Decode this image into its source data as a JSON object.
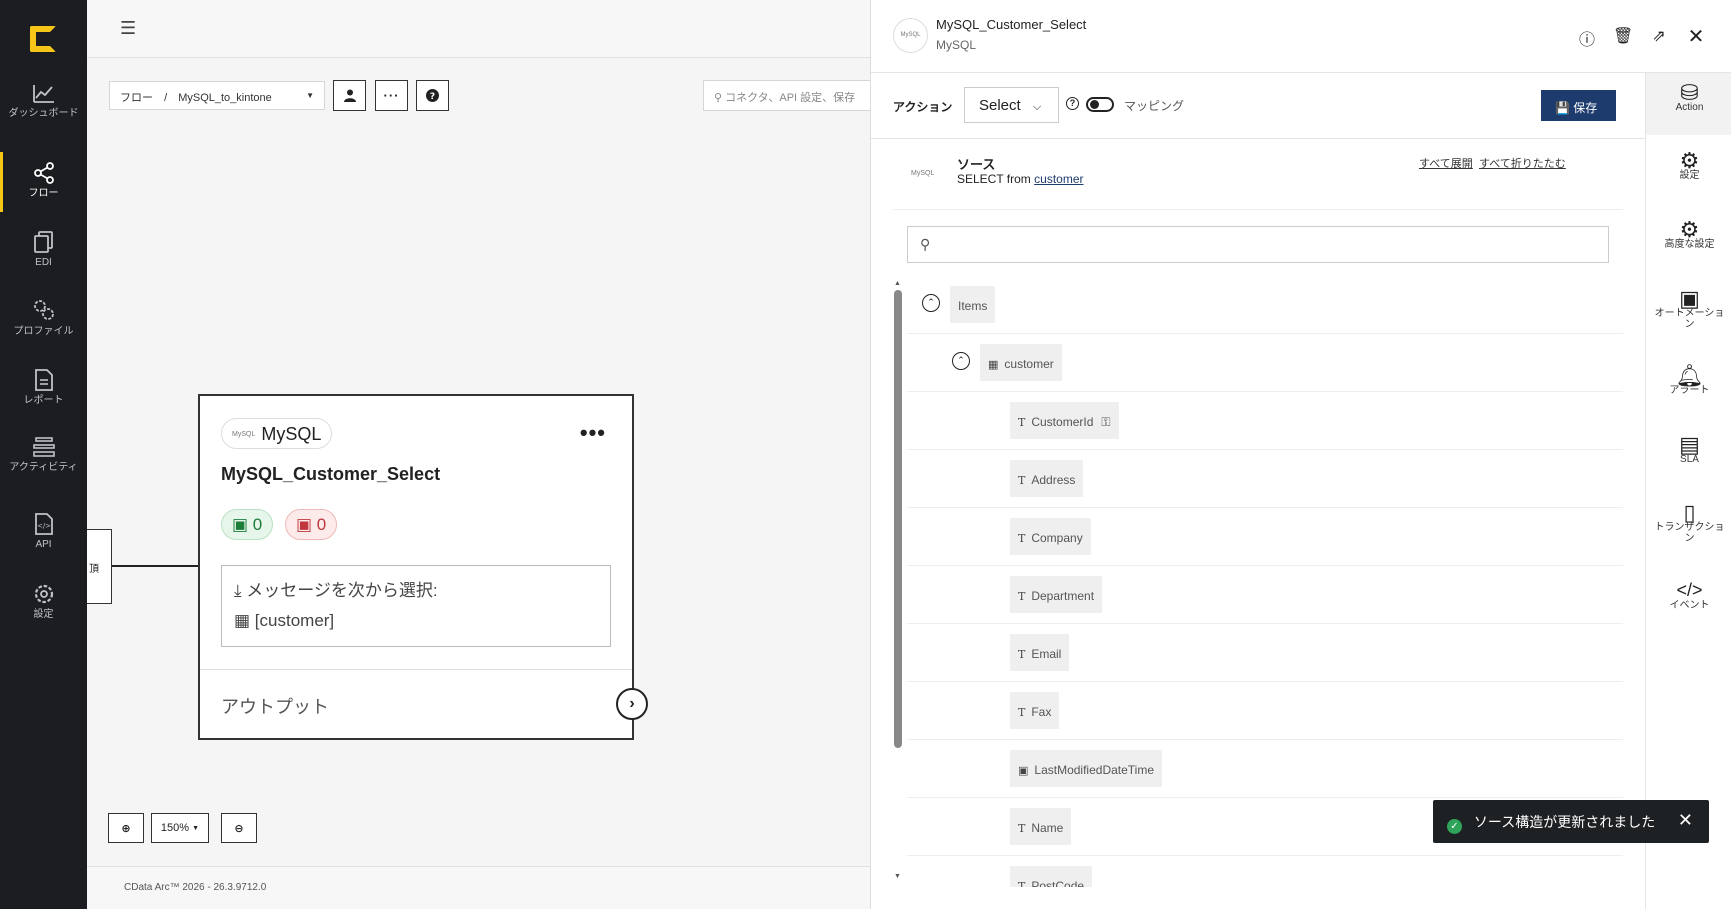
{
  "nav": {
    "items": [
      {
        "label": "ダッシュボード",
        "icon": "chart-line-icon"
      },
      {
        "label": "フロー",
        "icon": "share-nodes-icon"
      },
      {
        "label": "EDI",
        "icon": "documents-icon"
      },
      {
        "label": "プロファイル",
        "icon": "gears-icon"
      },
      {
        "label": "レポート",
        "icon": "report-icon"
      },
      {
        "label": "アクティビティ",
        "icon": "layers-icon"
      },
      {
        "label": "API",
        "icon": "api-file-icon"
      },
      {
        "label": "設定",
        "icon": "gear-icon"
      }
    ]
  },
  "canvas": {
    "breadcrumb_root": "フロー",
    "breadcrumb_sep": "/",
    "breadcrumb_current": "MySQL_to_kintone",
    "search_placeholder": "コネクタ、API 設定、保存",
    "stub_label": "頂",
    "zoom": "150%",
    "footer": "CData Arc™ 2026 - 26.3.9712.0"
  },
  "node": {
    "type": "MySQL",
    "type_mini": "MySQL",
    "title": "MySQL_Customer_Select",
    "ok_count": "0",
    "err_count": "0",
    "msg_label": "メッセージを次から選択:",
    "msg_table": "[customer]",
    "output": "アウトプット"
  },
  "panel": {
    "name": "MySQL_Customer_Select",
    "sub": "MySQL",
    "logo_text": "MySQL",
    "action_label": "アクション",
    "action_value": "Select",
    "mapping_label": "マッピング",
    "save_label": "保存",
    "source_title": "ソース",
    "source_prefix": "SELECT from",
    "source_table": "customer",
    "expand_all": "すべて展開",
    "collapse_all": "すべて折りたたむ",
    "tree": {
      "root": "Items",
      "table": "customer",
      "fields": [
        "CustomerId",
        "Address",
        "Company",
        "Department",
        "Email",
        "Fax",
        "LastModifiedDateTime",
        "Name",
        "PostCode"
      ]
    }
  },
  "rnav": {
    "items": [
      {
        "label": "Action",
        "icon": "database-icon"
      },
      {
        "label": "設定",
        "icon": "gear-icon"
      },
      {
        "label": "高度な設定",
        "icon": "gears-icon"
      },
      {
        "label": "オートメーション",
        "icon": "folder-gear-icon"
      },
      {
        "label": "アラート",
        "icon": "bell-icon"
      },
      {
        "label": "SLA",
        "icon": "sla-file-icon"
      },
      {
        "label": "トランザクション",
        "icon": "file-icon"
      },
      {
        "label": "イベント",
        "icon": "code-icon"
      }
    ]
  },
  "toast": {
    "message": "ソース構造が更新されました"
  },
  "colors": {
    "accent": "#f5c518",
    "save": "#1e3b6e",
    "nav_bg": "#1b1d21"
  }
}
